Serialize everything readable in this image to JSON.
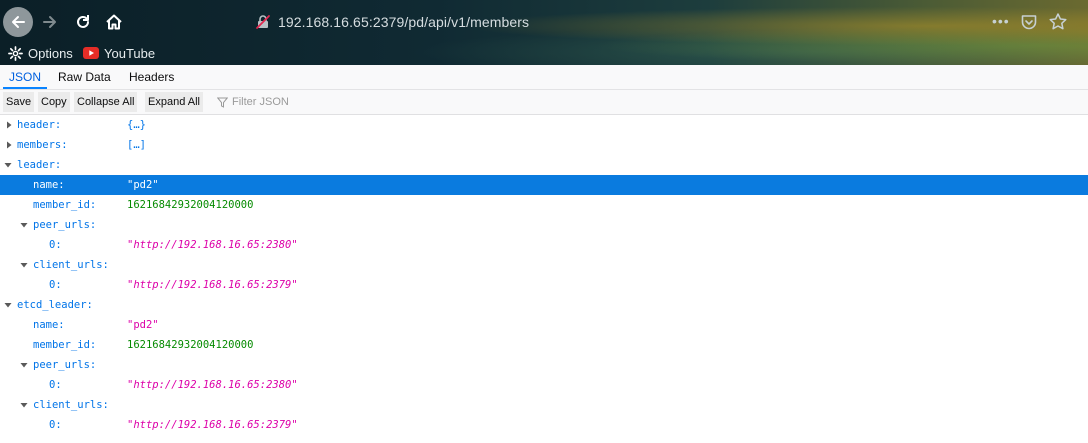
{
  "browser": {
    "url": "192.168.16.65:2379/pd/api/v1/members",
    "url_more": "•••",
    "bookmarks": [
      {
        "label": "Options"
      },
      {
        "label": "YouTube"
      }
    ]
  },
  "viewer": {
    "tabs": [
      {
        "label": "JSON",
        "active": true
      },
      {
        "label": "Raw Data",
        "active": false
      },
      {
        "label": "Headers",
        "active": false
      }
    ],
    "toolbar": {
      "save": "Save",
      "copy": "Copy",
      "collapse_all": "Collapse All",
      "expand_all": "Expand All",
      "filter_placeholder": "Filter JSON"
    }
  },
  "tree": {
    "rows": [
      {
        "key": "header:",
        "value": "{…}"
      },
      {
        "key": "members:",
        "value": "[…]"
      },
      {
        "key": "leader:",
        "value": ""
      },
      {
        "key": "name:",
        "value": "\"pd2\""
      },
      {
        "key": "member_id:",
        "value": "16216842932004120000"
      },
      {
        "key": "peer_urls:",
        "value": ""
      },
      {
        "key": "0:",
        "value": "\"http://192.168.16.65:2380\""
      },
      {
        "key": "client_urls:",
        "value": ""
      },
      {
        "key": "0:",
        "value": "\"http://192.168.16.65:2379\""
      },
      {
        "key": "etcd_leader:",
        "value": ""
      },
      {
        "key": "name:",
        "value": "\"pd2\""
      },
      {
        "key": "member_id:",
        "value": "16216842932004120000"
      },
      {
        "key": "peer_urls:",
        "value": ""
      },
      {
        "key": "0:",
        "value": "\"http://192.168.16.65:2380\""
      },
      {
        "key": "client_urls:",
        "value": ""
      },
      {
        "key": "0:",
        "value": "\"http://192.168.16.65:2379\""
      }
    ],
    "selected_row": 3
  },
  "colors": {
    "selection": "#0a7bdf",
    "key": "#0074e8",
    "string": "#dd00a9",
    "number": "#058b00"
  }
}
